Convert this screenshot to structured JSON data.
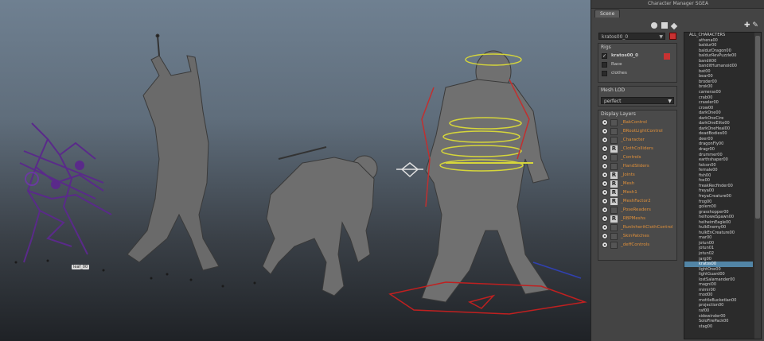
{
  "window": {
    "title": "Character Manager SGEA"
  },
  "tabs": [
    {
      "label": "Scene"
    }
  ],
  "character_select": {
    "value": "kratos00_0"
  },
  "rigs": {
    "header": "Rigs",
    "items": [
      {
        "label": "kratos00_0",
        "checked": true
      },
      {
        "label": "Race",
        "checked": false
      },
      {
        "label": "clothes",
        "checked": false
      }
    ]
  },
  "mesh_lod": {
    "header": "Mesh LOD",
    "value": "perfect"
  },
  "display_layers": {
    "header": "Display Layers",
    "items": [
      {
        "label": "_BakControl",
        "r": false
      },
      {
        "label": "_BRootLightControl",
        "r": false
      },
      {
        "label": "_Character",
        "r": false
      },
      {
        "label": "_ClothColliders",
        "r": true
      },
      {
        "label": "_Controls",
        "r": false
      },
      {
        "label": "_HandSliders",
        "r": false
      },
      {
        "label": "_Joints",
        "r": true
      },
      {
        "label": "_Mesh",
        "r": true
      },
      {
        "label": "_Mesh1",
        "r": true
      },
      {
        "label": "_MeshFactor2",
        "r": true
      },
      {
        "label": "_PoseReaders",
        "r": false
      },
      {
        "label": "_RBPMeshs",
        "r": true
      },
      {
        "label": "_RunInheritClothControl",
        "r": false
      },
      {
        "label": "_SkinPatches",
        "r": false
      },
      {
        "label": "_deffControls",
        "r": false
      }
    ]
  },
  "characters": {
    "root": "ALL_CHARACTERS",
    "items": [
      "athena00",
      "baldur00",
      "baldurDragon00",
      "baldurRevPuzzle00",
      "bandit00",
      "banditHumanoid00",
      "bat00",
      "bear00",
      "broder00",
      "brok00",
      "cameras00",
      "crab00",
      "crawler00",
      "crow00",
      "darkOne00",
      "darkOneCire",
      "darkOneElite00",
      "darkOneHeal00",
      "deadBodies00",
      "deer00",
      "dragonFly00",
      "dragr00",
      "drummer00",
      "earthshaper00",
      "falcon00",
      "female00",
      "fish00",
      "fox00",
      "freakRecfinder00",
      "freya00",
      "freyaCreature00",
      "frog00",
      "golem00",
      "grasshopper00",
      "helhoweSpawn00",
      "helheimEagle00",
      "hulkEnemy00",
      "hulkEnCreature00",
      "mar00",
      "jotun00",
      "jotun01",
      "jotun02",
      "jarg00",
      "kratos00",
      "lightOne00",
      "lightGuard00",
      "lostSalamander00",
      "magni00",
      "mimir00",
      "mod00",
      "mottleBucketlan00",
      "projection00",
      "raf00",
      "sidewinder00",
      "SoloFirePack00",
      "stag00"
    ],
    "selected": "kratos00"
  },
  "viewport": {
    "tag_label": "leaf_00"
  },
  "icons": [
    "refresh-icon",
    "list-icon",
    "wrench-icon",
    "plus-icon",
    "pencil-icon",
    "eye-icon"
  ]
}
